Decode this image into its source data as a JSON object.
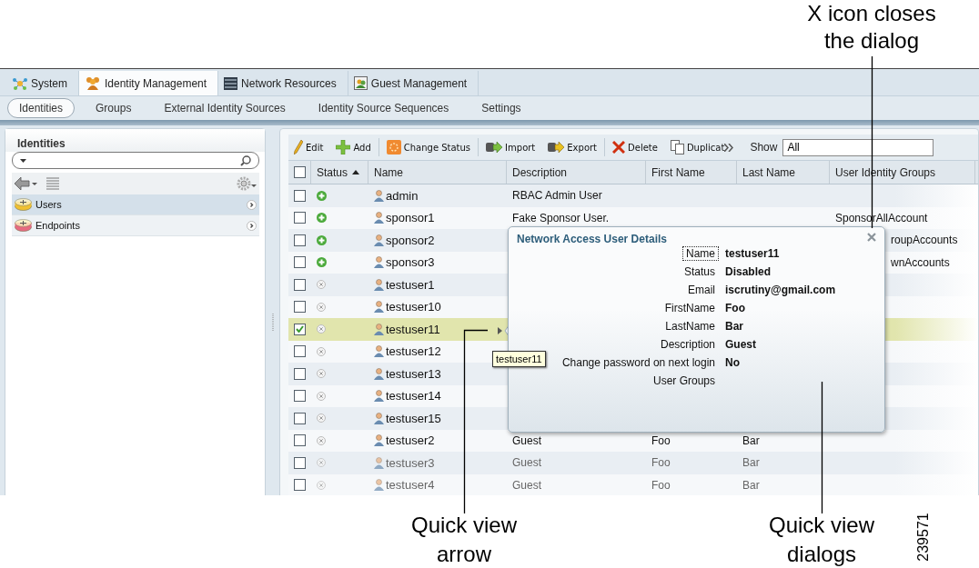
{
  "caption_top": "X icon closes the dialog",
  "tabs": [
    {
      "label": "System",
      "selected": false,
      "kind": "system"
    },
    {
      "label": "Identity Management",
      "selected": true,
      "kind": "identity"
    },
    {
      "label": "Network Resources",
      "selected": false,
      "kind": "network"
    },
    {
      "label": "Guest Management",
      "selected": false,
      "kind": "guest"
    }
  ],
  "subnav": [
    {
      "label": "Identities",
      "selected": true
    },
    {
      "label": "Groups",
      "selected": false
    },
    {
      "label": "External Identity Sources",
      "selected": false
    },
    {
      "label": "Identity Source Sequences",
      "selected": false
    },
    {
      "label": "Settings",
      "selected": false
    }
  ],
  "left_panel": {
    "title": "Identities",
    "items": [
      {
        "label": "Users",
        "selected": true,
        "kind": "users"
      },
      {
        "label": "Endpoints",
        "selected": false,
        "kind": "endpoints"
      }
    ]
  },
  "toolbar": [
    {
      "label": "Edit",
      "kind": "edit"
    },
    {
      "label": "Add",
      "kind": "add"
    },
    {
      "label": "Change Status",
      "kind": "status"
    },
    {
      "label": "Import",
      "kind": "import"
    },
    {
      "label": "Export",
      "kind": "export"
    },
    {
      "label": "Delete",
      "kind": "delete"
    },
    {
      "label": "Duplicat",
      "kind": "duplicate"
    }
  ],
  "show": {
    "label": "Show",
    "value": "All"
  },
  "table": {
    "header_checked": false,
    "columns": [
      {
        "label": "Status",
        "sorted": true
      },
      {
        "label": "Name",
        "sorted": false
      },
      {
        "label": "Description",
        "sorted": false
      },
      {
        "label": "First Name",
        "sorted": false
      },
      {
        "label": "Last Name",
        "sorted": false
      },
      {
        "label": "User Identity Groups",
        "sorted": false
      }
    ],
    "rows": [
      {
        "checked": false,
        "selected": false,
        "enabled": true,
        "name": "admin",
        "description": "RBAC Admin User"
      },
      {
        "checked": false,
        "selected": false,
        "enabled": true,
        "name": "sponsor1",
        "description": "Fake Sponsor User.",
        "groups": "SponsorAllAccount"
      },
      {
        "checked": false,
        "selected": false,
        "enabled": true,
        "name": "sponsor2",
        "groups": "roupAccounts",
        "groups_clipped": true
      },
      {
        "checked": false,
        "selected": false,
        "enabled": true,
        "name": "sponsor3",
        "groups": "wnAccounts",
        "groups_clipped": true
      },
      {
        "checked": false,
        "selected": false,
        "enabled": false,
        "name": "testuser1"
      },
      {
        "checked": false,
        "selected": false,
        "enabled": false,
        "name": "testuser10"
      },
      {
        "checked": true,
        "selected": true,
        "enabled": false,
        "name": "testuser11"
      },
      {
        "checked": false,
        "selected": false,
        "enabled": false,
        "name": "testuser12"
      },
      {
        "checked": false,
        "selected": false,
        "enabled": false,
        "name": "testuser13"
      },
      {
        "checked": false,
        "selected": false,
        "enabled": false,
        "name": "testuser14"
      },
      {
        "checked": false,
        "selected": false,
        "enabled": false,
        "name": "testuser15"
      },
      {
        "checked": false,
        "selected": false,
        "enabled": false,
        "name": "testuser2",
        "description": "Guest",
        "first_name": "Foo",
        "last_name": "Bar"
      },
      {
        "checked": false,
        "selected": false,
        "enabled": false,
        "name": "testuser3",
        "description": "Guest",
        "first_name": "Foo",
        "last_name": "Bar"
      },
      {
        "checked": false,
        "selected": false,
        "enabled": false,
        "name": "testuser4",
        "description": "Guest",
        "first_name": "Foo",
        "last_name": "Bar"
      }
    ]
  },
  "dialog": {
    "title": "Network Access User Details",
    "fields": [
      {
        "label": "Name",
        "value": "testuser11",
        "focused": true
      },
      {
        "label": "Status",
        "value": "Disabled",
        "focused": false
      },
      {
        "label": "Email",
        "value": "iscrutiny@gmail.com",
        "focused": false
      },
      {
        "label": "FirstName",
        "value": "Foo",
        "focused": false
      },
      {
        "label": "LastName",
        "value": "Bar",
        "focused": false
      },
      {
        "label": "Description",
        "value": "Guest",
        "focused": false
      },
      {
        "label": "Change password on next login",
        "value": "No",
        "focused": false
      },
      {
        "label": "User Groups",
        "focused": false
      }
    ]
  },
  "tooltip": "testuser11",
  "captions": [
    "Quick view arrow",
    "Quick view dialogs"
  ],
  "figure_number": "239571"
}
